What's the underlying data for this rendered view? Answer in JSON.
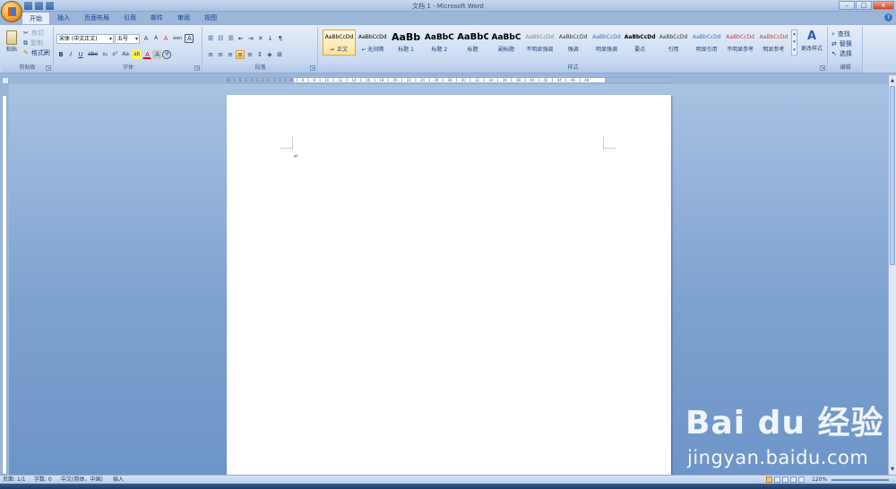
{
  "titlebar": {
    "title": "文档 1 - Microsoft Word"
  },
  "window_controls": {
    "minimize": "–",
    "maximize": "□",
    "close": "x"
  },
  "tabs": [
    {
      "label": "开始"
    },
    {
      "label": "插入"
    },
    {
      "label": "页面布局"
    },
    {
      "label": "引用"
    },
    {
      "label": "邮件"
    },
    {
      "label": "审阅"
    },
    {
      "label": "视图"
    }
  ],
  "clipboard": {
    "paste": "粘贴",
    "cut": "剪切",
    "copy": "复制",
    "format_painter": "格式刷",
    "group": "剪贴板"
  },
  "font": {
    "font_name": "宋体 (中文正文)",
    "font_size": "五号",
    "grow": "A",
    "shrink": "A",
    "clear": "A",
    "pinyin": "wen",
    "border": "A",
    "bold": "B",
    "italic": "I",
    "underline": "U",
    "strike": "abe",
    "subscript": "x₂",
    "superscript": "x²",
    "case": "Aa",
    "highlight": "ab",
    "color": "A",
    "shading": "A",
    "enclose": "字",
    "group": "字体"
  },
  "paragraph": {
    "group": "段落"
  },
  "styles": {
    "group": "样式",
    "items": [
      {
        "preview": "AaBbCcDd",
        "name": "↵ 正文"
      },
      {
        "preview": "AaBbCcDd",
        "name": "↵ 无间隔"
      },
      {
        "preview": "AaBb",
        "name": "标题 1"
      },
      {
        "preview": "AaBbC",
        "name": "标题 2"
      },
      {
        "preview": "AaBbC",
        "name": "标题"
      },
      {
        "preview": "AaBbC",
        "name": "副标题"
      },
      {
        "preview": "AaBbCcDd",
        "name": "不明显强调"
      },
      {
        "preview": "AaBbCcDd",
        "name": "强调"
      },
      {
        "preview": "AaBbCcDd",
        "name": "明显强调"
      },
      {
        "preview": "AaBbCcDd",
        "name": "要点"
      },
      {
        "preview": "AaBbCcDd",
        "name": "引用"
      },
      {
        "preview": "AaBbCcDd",
        "name": "明显引用"
      },
      {
        "preview": "AaBbCcDd",
        "name": "不明显参考"
      },
      {
        "preview": "AaBbCcDd",
        "name": "明显参考"
      }
    ],
    "change_styles": "更改样式"
  },
  "editing": {
    "group": "编辑",
    "find": "查找",
    "replace": "替换",
    "select": "选择"
  },
  "ruler": {
    "ticks": "8 · 1 · 6 · 1 · 4 · 1 · 2 · 1 · 1 · 2 · 1 · 4 · 1 · 6 · 1 · 8 · 1 · 10 · 1 · 12 · 1 · 14 · 1 · 16 · 1 · 18 · 1 · 20 · 1 · 22 · 1 · 24 · 1 · 26 · 1 · 28 · 1 · 30 · 1 · 32 · 1 · 34 · 1 · 36 · 1 · 38 · 1 · 40 · 1 · 42 · 1 · 44 · 1 · 46 · 1 · 48"
  },
  "document": {
    "paragraph_mark": "↵"
  },
  "statusbar": {
    "page": "页面: 1/1",
    "words": "字数: 0",
    "language": "中文(简体，中国)",
    "mode": "插入",
    "zoom": "120%"
  },
  "watermark": {
    "logo": "Bai du 经验",
    "url": "jingyan.baidu.com"
  }
}
